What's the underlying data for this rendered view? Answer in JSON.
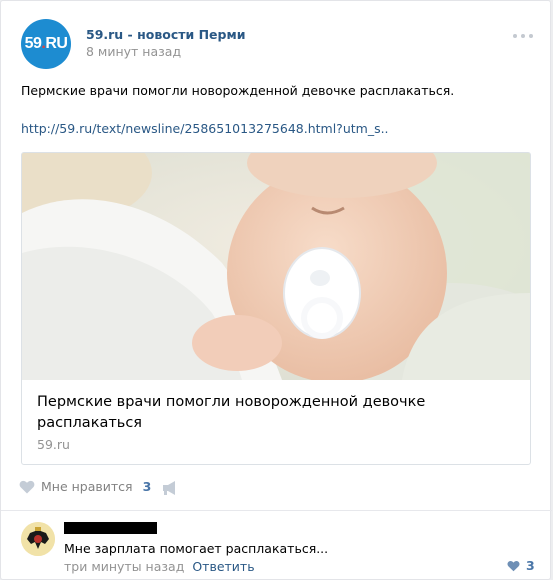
{
  "post": {
    "group_name": "59.ru - новости Перми",
    "time": "8 минут назад",
    "text": "Пермские врачи помогли новорожденной девочке расплакаться.",
    "link": "http://59.ru/text/newsline/258651013275648.html?utm_s.."
  },
  "avatar_logo": {
    "main": "59",
    "dot": ".",
    "suffix": "RU"
  },
  "attachment": {
    "title": "Пермские врачи помогли новорожденной девочке расплакаться",
    "domain": "59.ru"
  },
  "actions": {
    "like_label": "Мне нравится",
    "like_count": "3"
  },
  "comment": {
    "text": "Мне зарплата помогает расплакаться...",
    "time": "три минуты назад",
    "reply_label": "Ответить",
    "like_count": "3"
  },
  "colors": {
    "link": "#2a5885",
    "accent": "#4a76a8",
    "avatar_bg": "#1d8cd1"
  }
}
